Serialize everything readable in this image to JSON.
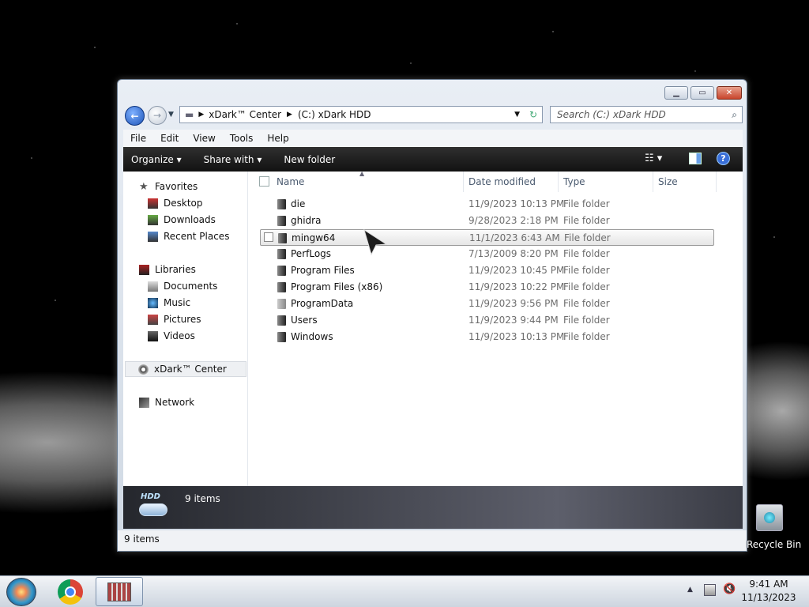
{
  "window": {
    "address": {
      "crumbs": [
        "xDark™ Center",
        "(C:) xDark HDD"
      ]
    },
    "search_placeholder": "Search (C:) xDark HDD",
    "menu": [
      "File",
      "Edit",
      "View",
      "Tools",
      "Help"
    ],
    "toolbar": {
      "organize": "Organize",
      "share_with": "Share with",
      "new_folder": "New folder"
    },
    "nav": {
      "favorites": "Favorites",
      "favorites_items": [
        "Desktop",
        "Downloads",
        "Recent Places"
      ],
      "libraries": "Libraries",
      "libraries_items": [
        "Documents",
        "Music",
        "Pictures",
        "Videos"
      ],
      "computer": "xDark™ Center",
      "network": "Network"
    },
    "columns": {
      "name": "Name",
      "date": "Date modified",
      "type": "Type",
      "size": "Size"
    },
    "files": [
      {
        "name": "die",
        "date": "11/9/2023 10:13 PM",
        "type": "File folder"
      },
      {
        "name": "ghidra",
        "date": "9/28/2023 2:18 PM",
        "type": "File folder"
      },
      {
        "name": "mingw64",
        "date": "11/1/2023 6:43 AM",
        "type": "File folder"
      },
      {
        "name": "PerfLogs",
        "date": "7/13/2009 8:20 PM",
        "type": "File folder"
      },
      {
        "name": "Program Files",
        "date": "11/9/2023 10:45 PM",
        "type": "File folder"
      },
      {
        "name": "Program Files (x86)",
        "date": "11/9/2023 10:22 PM",
        "type": "File folder"
      },
      {
        "name": "ProgramData",
        "date": "11/9/2023 9:56 PM",
        "type": "File folder"
      },
      {
        "name": "Users",
        "date": "11/9/2023 9:44 PM",
        "type": "File folder"
      },
      {
        "name": "Windows",
        "date": "11/9/2023 10:13 PM",
        "type": "File folder"
      }
    ],
    "details_count": "9 items",
    "drive_logo": "HDD",
    "status": "9 items"
  },
  "desktop": {
    "recycle_bin": "Recycle Bin"
  },
  "taskbar": {
    "time": "9:41 AM",
    "date": "11/13/2023"
  },
  "colors": {
    "toolbar": "#1f1f1f",
    "details_pane": "#3b3d45",
    "selection": "#e8e8e8",
    "accent": "#3a6fd8"
  }
}
